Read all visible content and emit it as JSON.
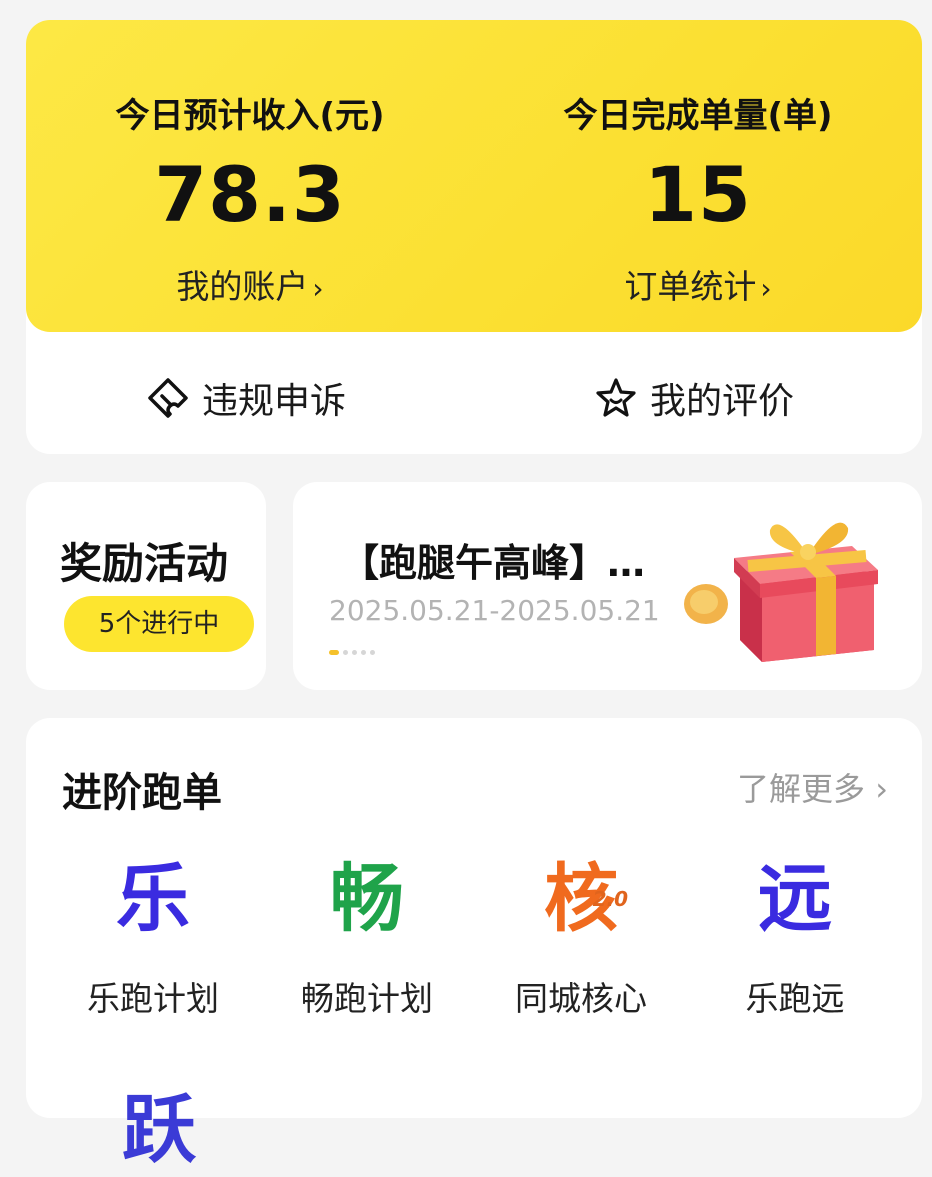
{
  "stats": {
    "income_label": "今日预计收入(元)",
    "income_value": "78.3",
    "account_link": "我的账户",
    "orders_label": "今日完成单量(单)",
    "orders_value": "15",
    "order_stats_link": "订单统计",
    "chevron": "›"
  },
  "actions": {
    "appeal_label": "违规申诉",
    "appeal_icon": "ticket-icon",
    "review_label": "我的评价",
    "review_icon": "star-face-icon"
  },
  "reward": {
    "title": "奖励活动",
    "badge": "5个进行中"
  },
  "banner": {
    "title": "【跑腿午高峰】…",
    "date": "2025.05.21-2025.05.21",
    "page_dots": 5,
    "active_dot": 1,
    "image_icon": "gift-box-icon"
  },
  "advanced": {
    "title": "进阶跑单",
    "more": "了解更多 ›",
    "programs": [
      {
        "glyph": "乐",
        "label": "乐跑计划",
        "color": "#3a2be0"
      },
      {
        "glyph": "畅",
        "label": "畅跑计划",
        "color": "#1fa34a"
      },
      {
        "glyph": "核",
        "sub": "2.0",
        "label": "同城核心",
        "color": "#f06a1e"
      },
      {
        "glyph": "远",
        "label": "乐跑远",
        "color": "#3a2be0"
      }
    ],
    "partial_glyph": "跃"
  },
  "colors": {
    "accent_yellow": "#fbe032",
    "muted_text": "#9a9a9a"
  }
}
